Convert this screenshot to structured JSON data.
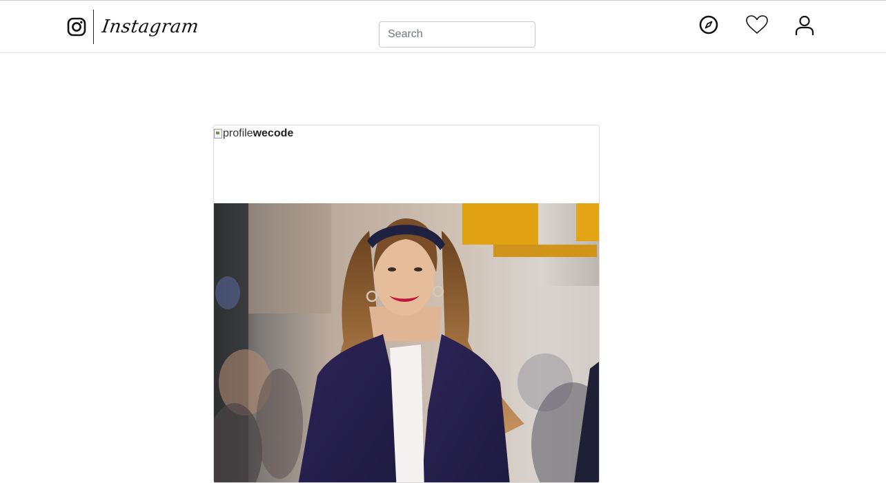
{
  "topbar": {
    "logo_text": "Instagram",
    "search": {
      "placeholder": "Search",
      "value": ""
    },
    "icons": [
      "explore-compass-icon",
      "heart-icon",
      "profile-icon"
    ]
  },
  "post": {
    "avatar_alt": "profile",
    "username": "wecode",
    "photo_subject": "woman with long wavy hair in navy coat smiling on city street"
  },
  "colors": {
    "border": "#dbdbdb",
    "text": "#222222",
    "placeholder": "#6c757d",
    "background": "#ffffff"
  }
}
